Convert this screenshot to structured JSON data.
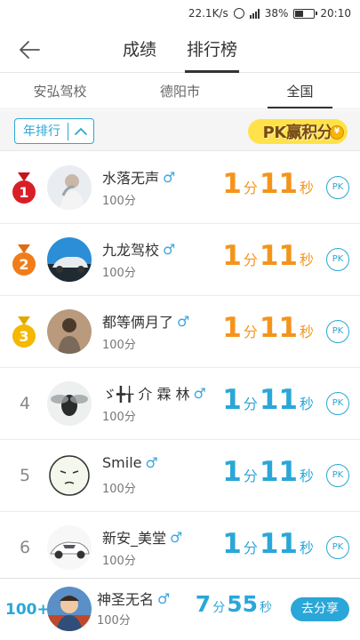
{
  "status_bar": {
    "speed": "22.1K/s",
    "battery": "38%",
    "time": "20:10",
    "battery_level": 0.38
  },
  "header": {
    "back_icon": "arrow-left-icon",
    "tabs": [
      {
        "label": "成绩",
        "active": false
      },
      {
        "label": "排行榜",
        "active": true
      }
    ]
  },
  "scope_tabs": [
    {
      "label": "安弘驾校",
      "active": false
    },
    {
      "label": "德阳市",
      "active": false
    },
    {
      "label": "全国",
      "active": true
    }
  ],
  "filter": {
    "label": "年排行",
    "arrow_icon": "chevron-up-icon",
    "pk_banner": "PK赢积分",
    "coin_symbol": "¥"
  },
  "colors": {
    "accent_blue": "#2aa7d8",
    "accent_orange": "#f4941c",
    "gender_blue": "#3aa5e0"
  },
  "ranking": [
    {
      "rank": "1",
      "name": "水落无声",
      "gender": "♂",
      "points": "100分",
      "minutes": "1",
      "min_unit": "分",
      "seconds": "11",
      "sec_unit": "秒",
      "pk": "PK",
      "medal": "gold-medal-red",
      "avatar_icon": "avatar-photo-icon"
    },
    {
      "rank": "2",
      "name": "九龙驾校",
      "gender": "♂",
      "points": "100分",
      "minutes": "1",
      "min_unit": "分",
      "seconds": "11",
      "sec_unit": "秒",
      "pk": "PK",
      "medal": "medal-orange",
      "avatar_icon": "car-avatar-icon"
    },
    {
      "rank": "3",
      "name": "都等俩月了",
      "gender": "♂",
      "points": "100分",
      "minutes": "1",
      "min_unit": "分",
      "seconds": "11",
      "sec_unit": "秒",
      "pk": "PK",
      "medal": "medal-yellow",
      "avatar_icon": "avatar-photo-icon"
    },
    {
      "rank": "4",
      "name": "ゞ╋╁ 介 霖 林",
      "gender": "♂",
      "points": "100分",
      "minutes": "1",
      "min_unit": "分",
      "seconds": "11",
      "sec_unit": "秒",
      "pk": "PK",
      "medal": "",
      "avatar_icon": "fly-avatar-icon"
    },
    {
      "rank": "5",
      "name": "Smile",
      "gender": "♂",
      "points": "100分",
      "minutes": "1",
      "min_unit": "分",
      "seconds": "11",
      "sec_unit": "秒",
      "pk": "PK",
      "medal": "",
      "avatar_icon": "face-avatar-icon"
    },
    {
      "rank": "6",
      "name": "新安_美堂",
      "gender": "♂",
      "points": "100分",
      "minutes": "1",
      "min_unit": "分",
      "seconds": "11",
      "sec_unit": "秒",
      "pk": "PK",
      "medal": "",
      "avatar_icon": "car-avatar-icon"
    }
  ],
  "my_rank": {
    "rank": "100+",
    "name": "神圣无名",
    "gender": "♂",
    "points": "100分",
    "minutes": "7",
    "min_unit": "分",
    "seconds": "55",
    "sec_unit": "秒",
    "share_label": "去分享",
    "avatar_icon": "avatar-photo-icon"
  }
}
